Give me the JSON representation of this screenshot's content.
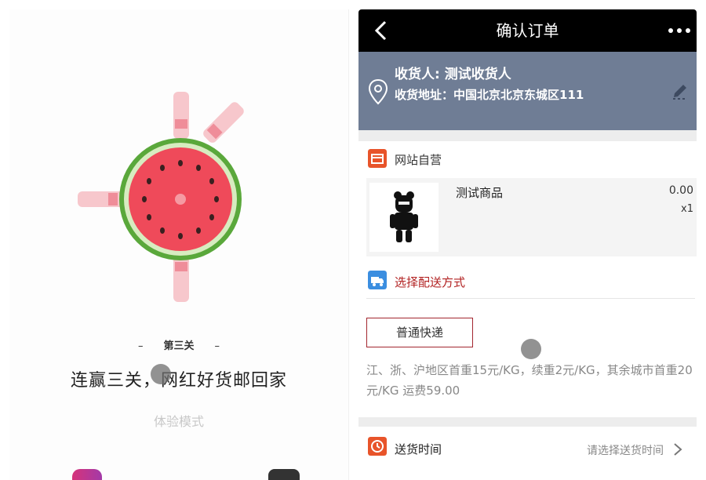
{
  "left": {
    "level_label": "第三关",
    "level_dash": "–",
    "slogan": "连赢三关，网红好货邮回家",
    "mode_label": "体验模式"
  },
  "order": {
    "title": "确认订单",
    "back_icon": "chevron-left-icon",
    "more_icon": "more-dots-icon",
    "address": {
      "receiver": "收货人: 测试收货人",
      "address": "收货地址：中国北京北京东城区111",
      "pin_icon": "location-pin-icon",
      "edit_icon": "pencil-icon"
    },
    "store": {
      "label": "网站自营",
      "icon": "shop-icon",
      "icon_color": "#e8542a"
    },
    "product": {
      "name": "测试商品",
      "price": "0.00",
      "quantity": "x1"
    },
    "shipping": {
      "label": "选择配送方式",
      "icon": "truck-icon",
      "icon_color": "#3b8ee0",
      "option_label": "普通快递",
      "description": "江、浙、沪地区首重15元/KG，续重2元/KG，其余城市首重20元/KG 运费59.00"
    },
    "delivery_time": {
      "label": "送货时间",
      "hint": "请选择送货时间",
      "icon": "clock-icon",
      "icon_color": "#e8542a"
    }
  },
  "colors": {
    "address_bg": "#6f7d95",
    "topbar_bg": "#000000",
    "accent_red": "#b22222"
  }
}
